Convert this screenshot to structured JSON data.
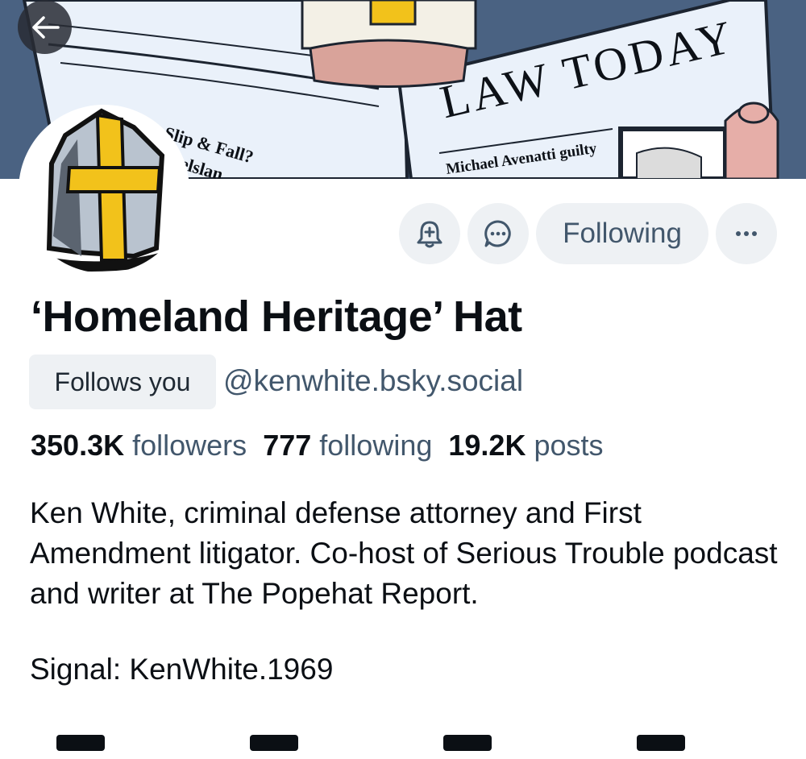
{
  "banner": {
    "newspaper_title": "LAW TODAY",
    "headline_left_1": "Slip & Fall?",
    "headline_left_2": "elslan",
    "headline_right": "Michael Avenatti guilty",
    "icon": "newspaper-cartoon"
  },
  "back_button": {
    "icon": "arrow-left-icon"
  },
  "avatar": {
    "icon": "mitre-hat-icon"
  },
  "actions": {
    "subscribe_icon": "bell-plus-icon",
    "message_icon": "chat-bubble-icon",
    "follow_label": "Following",
    "more_icon": "ellipsis-icon"
  },
  "profile": {
    "display_name": "‘Homeland Heritage’ Hat",
    "follows_you": "Follows you",
    "handle": "@kenwhite.bsky.social"
  },
  "stats": {
    "followers_count": "350.3K",
    "followers_label": "followers",
    "following_count": "777",
    "following_label": "following",
    "posts_count": "19.2K",
    "posts_label": "posts"
  },
  "bio": {
    "text": "Ken White, criminal defense attorney and First Amendment litigator.  Co-host of Serious Trouble podcast and writer at The Popehat Report.",
    "signal": "Signal:  KenWhite.1969"
  },
  "colors": {
    "banner_bg": "#4a6282",
    "button_bg": "#eef1f4",
    "secondary_text": "#42576c",
    "primary_text": "#0b0f14",
    "cross_yellow": "#f2c21b"
  }
}
